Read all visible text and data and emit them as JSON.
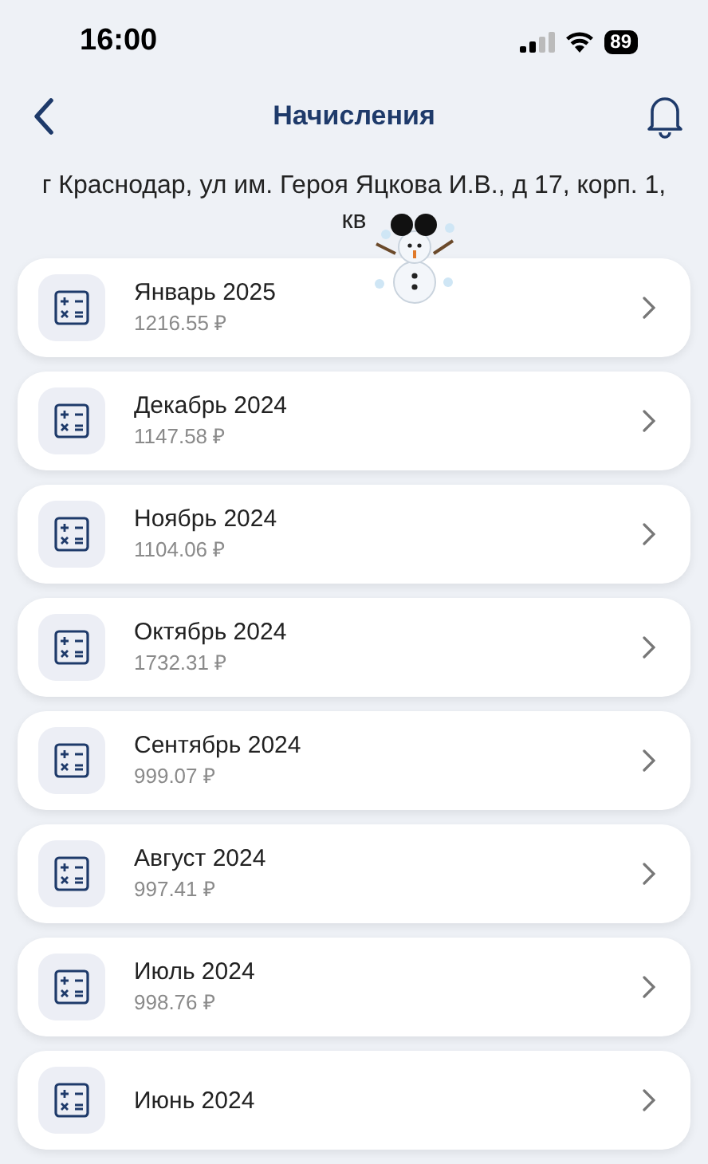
{
  "status_bar": {
    "time": "16:00",
    "battery": "89"
  },
  "header": {
    "title": "Начисления"
  },
  "address": "г Краснодар, ул им. Героя Яцкова И.В., д 17, корп. 1, кв",
  "charges": [
    {
      "month": "Январь 2025",
      "amount": "1216.55 ₽"
    },
    {
      "month": "Декабрь 2024",
      "amount": "1147.58 ₽"
    },
    {
      "month": "Ноябрь 2024",
      "amount": "1104.06 ₽"
    },
    {
      "month": "Октябрь 2024",
      "amount": "1732.31 ₽"
    },
    {
      "month": "Сентябрь 2024",
      "amount": "999.07 ₽"
    },
    {
      "month": "Август 2024",
      "amount": "997.41 ₽"
    },
    {
      "month": "Июль 2024",
      "amount": "998.76 ₽"
    },
    {
      "month": "Июнь 2024"
    }
  ]
}
